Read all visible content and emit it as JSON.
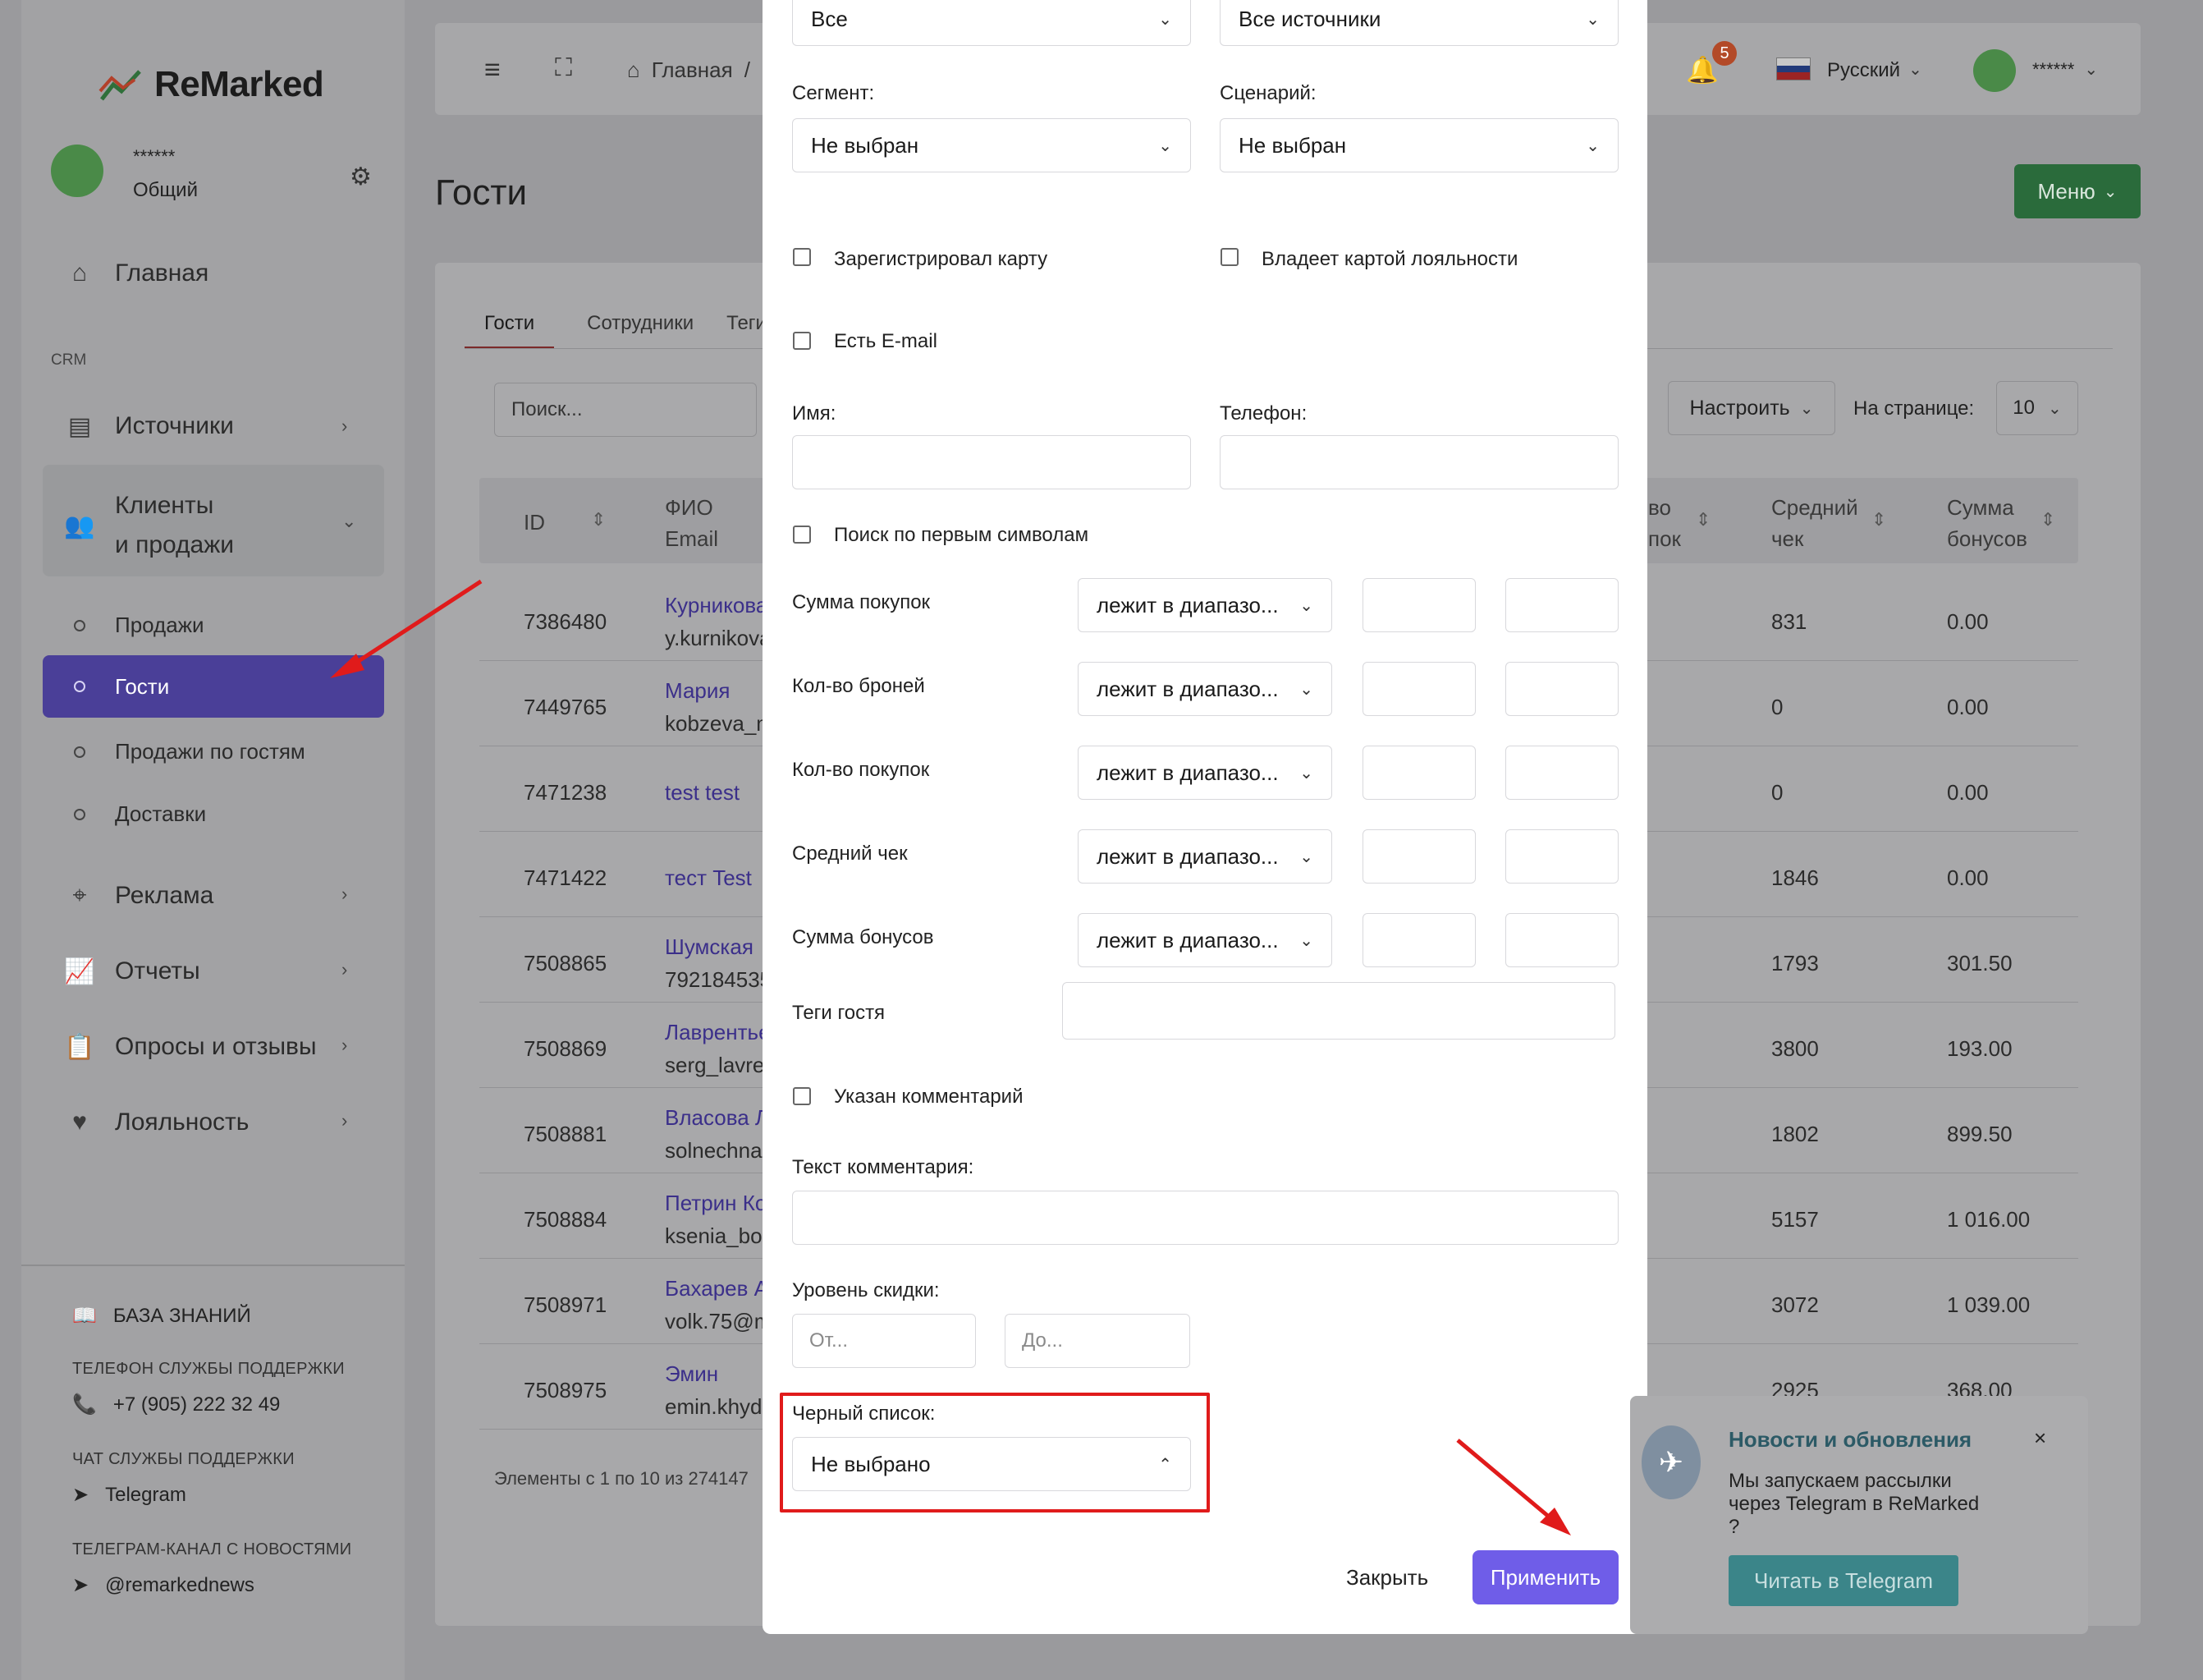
{
  "app": {
    "brand": "ReMarked",
    "user_masked": "******",
    "account_type": "Общий"
  },
  "sidebar": {
    "home": "Главная",
    "section_crm": "CRM",
    "sources": "Источники",
    "clients_sales_1": "Клиенты",
    "clients_sales_2": "и продажи",
    "sub_sales": "Продажи",
    "sub_guests": "Гости",
    "sub_sales_by_guest": "Продажи по гостям",
    "sub_delivery": "Доставки",
    "ads": "Реклама",
    "reports": "Отчеты",
    "surveys": "Опросы и отзывы",
    "loyalty": "Лояльность",
    "kb": "БАЗА ЗНАНИЙ",
    "support_phone_title": "ТЕЛЕФОН СЛУЖБЫ ПОДДЕРЖКИ",
    "support_phone": "+7 (905) 222 32 49",
    "support_chat_title": "ЧАТ СЛУЖБЫ ПОДДЕРЖКИ",
    "support_chat": "Telegram",
    "news_channel_title": "ТЕЛЕГРАМ-КАНАЛ С НОВОСТЯМИ",
    "news_channel": "@remarkednews"
  },
  "header": {
    "breadcrumb_home": "Главная",
    "breadcrumb_sep": "/",
    "notif_count": "5",
    "language": "Русский",
    "user_masked": "******"
  },
  "page": {
    "title": "Гости",
    "menu_button": "Меню"
  },
  "tabs": [
    "Гости",
    "Сотрудники",
    "Теги"
  ],
  "toolbar": {
    "search_placeholder": "Поиск...",
    "configure": "Настроить",
    "per_page_label": "На странице:",
    "per_page": "10"
  },
  "table": {
    "h_id": "ID",
    "h_fio": "ФИО",
    "h_email": "Email",
    "h_cnt_1": "во",
    "h_cnt_2": "пок",
    "h_avg_1": "Средний",
    "h_avg_2": "чек",
    "h_bonus_1": "Сумма",
    "h_bonus_2": "бонусов",
    "rows": [
      {
        "id": "7386480",
        "name": "Курникова",
        "email": "y.kurnikova",
        "avg": "831",
        "bonus": "0.00"
      },
      {
        "id": "7449765",
        "name": "Мария",
        "email": "kobzeva_m",
        "avg": "0",
        "bonus": "0.00"
      },
      {
        "id": "7471238",
        "name": "test test",
        "email": "",
        "avg": "0",
        "bonus": "0.00"
      },
      {
        "id": "7471422",
        "name": "тест Test",
        "email": "",
        "avg": "1846",
        "bonus": "0.00"
      },
      {
        "id": "7508865",
        "name": "Шумская",
        "email": "792184535",
        "avg": "1793",
        "bonus": "301.50"
      },
      {
        "id": "7508869",
        "name": "Лаврентье",
        "email": "serg_lavre",
        "avg": "3800",
        "bonus": "193.00"
      },
      {
        "id": "7508881",
        "name": "Власова Л",
        "email": "solnechna",
        "avg": "1802",
        "bonus": "899.50"
      },
      {
        "id": "7508884",
        "name": "Петрин Ко",
        "email": "ksenia_bor",
        "avg": "5157",
        "bonus": "1 016.00"
      },
      {
        "id": "7508971",
        "name": "Бахарев А",
        "email": "volk.75@m",
        "avg": "3072",
        "bonus": "1 039.00"
      },
      {
        "id": "7508975",
        "name": "Эмин",
        "email": "emin.khyd",
        "avg": "2925",
        "bonus": "368.00"
      }
    ],
    "footer": "Элементы с 1 по 10 из 274147"
  },
  "modal": {
    "top_sel_1": "Все",
    "top_sel_2": "Все источники",
    "segment_label": "Сегмент:",
    "segment_value": "Не выбран",
    "scenario_label": "Сценарий:",
    "scenario_value": "Не выбран",
    "cb_card": "Зарегистрировал карту",
    "cb_loyalty": "Владеет картой лояльности",
    "cb_email": "Есть E-mail",
    "name_label": "Имя:",
    "phone_label": "Телефон:",
    "cb_first_symbols": "Поиск по первым символам",
    "range_rows": [
      {
        "label": "Сумма покупок",
        "op": "лежит в диапазо..."
      },
      {
        "label": "Кол-во броней",
        "op": "лежит в диапазо..."
      },
      {
        "label": "Кол-во покупок",
        "op": "лежит в диапазо..."
      },
      {
        "label": "Средний чек",
        "op": "лежит в диапазо..."
      },
      {
        "label": "Сумма бонусов",
        "op": "лежит в диапазо..."
      }
    ],
    "tags_label": "Теги гостя",
    "cb_comment": "Указан комментарий",
    "comment_label": "Текст комментария:",
    "discount_label": "Уровень скидки:",
    "discount_from": "От...",
    "discount_to": "До...",
    "blacklist_label": "Черный список:",
    "blacklist_value": "Не выбрано",
    "close": "Закрыть",
    "apply": "Применить"
  },
  "news": {
    "title": "Новости и обновления",
    "text_1": "Мы запускаем рассылки",
    "text_2": "через Telegram в ReMarked",
    "text_3": "?",
    "button": "Читать в Telegram"
  }
}
